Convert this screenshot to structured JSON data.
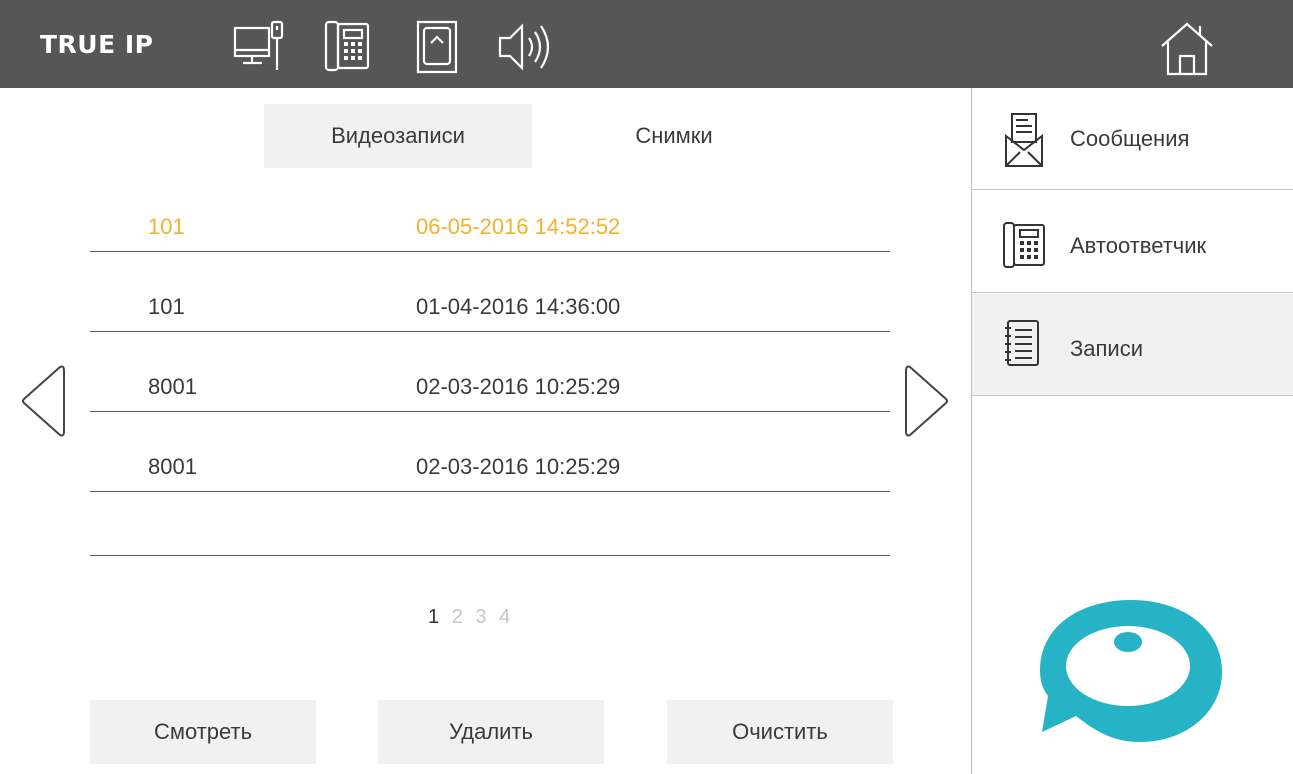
{
  "header": {
    "brand": "TRUE IP",
    "icons": [
      "monitor-icon",
      "intercom-phone-icon",
      "sd-card-icon",
      "speaker-icon"
    ],
    "home_icon": "home-icon",
    "bg_color": "#565656"
  },
  "tabs": [
    {
      "label": "Видеозаписи",
      "active": true
    },
    {
      "label": "Снимки",
      "active": false
    }
  ],
  "records": [
    {
      "id": "101",
      "datetime": "06-05-2016 14:52:52",
      "selected": true
    },
    {
      "id": "101",
      "datetime": "01-04-2016 14:36:00",
      "selected": false
    },
    {
      "id": "8001",
      "datetime": "02-03-2016 10:25:29",
      "selected": false
    },
    {
      "id": "8001",
      "datetime": "02-03-2016 10:25:29",
      "selected": false
    },
    {
      "id": "",
      "datetime": "",
      "selected": false
    }
  ],
  "pagination": {
    "current": "1",
    "pages": [
      "2",
      "3",
      "4"
    ]
  },
  "actions": {
    "view": "Смотреть",
    "delete": "Удалить",
    "clear": "Очистить"
  },
  "side_menu": [
    {
      "label": "Сообщения",
      "icon": "message-envelope-icon",
      "active": false
    },
    {
      "label": "Автоответчик",
      "icon": "answering-machine-icon",
      "active": false
    },
    {
      "label": "Записи",
      "icon": "notebook-icon",
      "active": true
    }
  ],
  "colors": {
    "accent": "#f3b12f",
    "logo": "#26b3c6",
    "active_bg": "#f1f1f1"
  }
}
